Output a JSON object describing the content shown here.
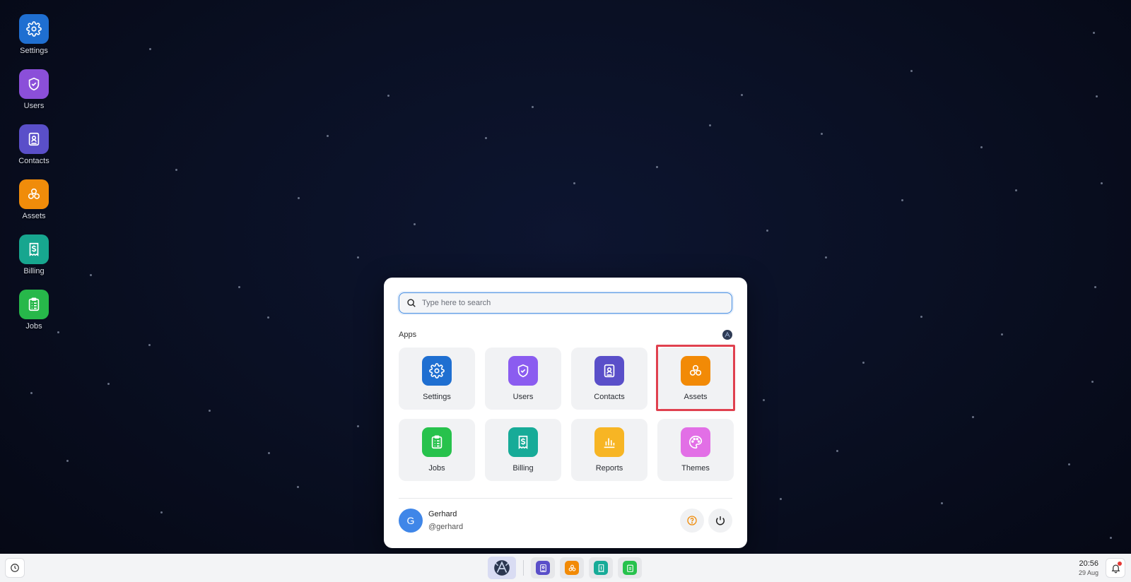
{
  "desktop": {
    "icons": [
      {
        "label": "Settings",
        "icon": "gear-icon",
        "color": "#1f6fd1"
      },
      {
        "label": "Users",
        "icon": "shield-check-icon",
        "color": "#8b4fd9"
      },
      {
        "label": "Contacts",
        "icon": "contact-book-icon",
        "color": "#5a4fc9"
      },
      {
        "label": "Assets",
        "icon": "boxes-icon",
        "color": "#f08c0a"
      },
      {
        "label": "Billing",
        "icon": "receipt-dollar-icon",
        "color": "#17a68f"
      },
      {
        "label": "Jobs",
        "icon": "clipboard-icon",
        "color": "#27b84a"
      }
    ]
  },
  "launcher": {
    "search": {
      "placeholder": "Type here to search",
      "value": ""
    },
    "apps_title": "Apps",
    "apps": [
      {
        "label": "Settings",
        "icon": "gear-icon",
        "color": "#1f6fd1"
      },
      {
        "label": "Users",
        "icon": "shield-check-icon",
        "color": "#8b5cf0"
      },
      {
        "label": "Contacts",
        "icon": "contact-book-icon",
        "color": "#5a4fc9"
      },
      {
        "label": "Assets",
        "icon": "boxes-icon",
        "color": "#f28a06",
        "highlighted": true
      },
      {
        "label": "Jobs",
        "icon": "clipboard-icon",
        "color": "#27c24c"
      },
      {
        "label": "Billing",
        "icon": "receipt-dollar-icon",
        "color": "#17ab98"
      },
      {
        "label": "Reports",
        "icon": "bar-chart-icon",
        "color": "#f7b524"
      },
      {
        "label": "Themes",
        "icon": "palette-icon",
        "color": "#e26fe6"
      }
    ],
    "user": {
      "initial": "G",
      "name": "Gerhard",
      "handle": "@gerhard"
    }
  },
  "taskbar": {
    "pinned": [
      {
        "icon": "contact-book-icon",
        "color": "#5a4fc9"
      },
      {
        "icon": "boxes-icon",
        "color": "#f28a06"
      },
      {
        "icon": "receipt-dollar-icon",
        "color": "#17ab98"
      },
      {
        "icon": "clipboard-icon",
        "color": "#27c24c"
      }
    ],
    "time": "20:56",
    "date": "29 Aug"
  },
  "colors": {
    "highlight": "#e0414f",
    "accent": "#4a90e2",
    "notification": "#e53935"
  }
}
